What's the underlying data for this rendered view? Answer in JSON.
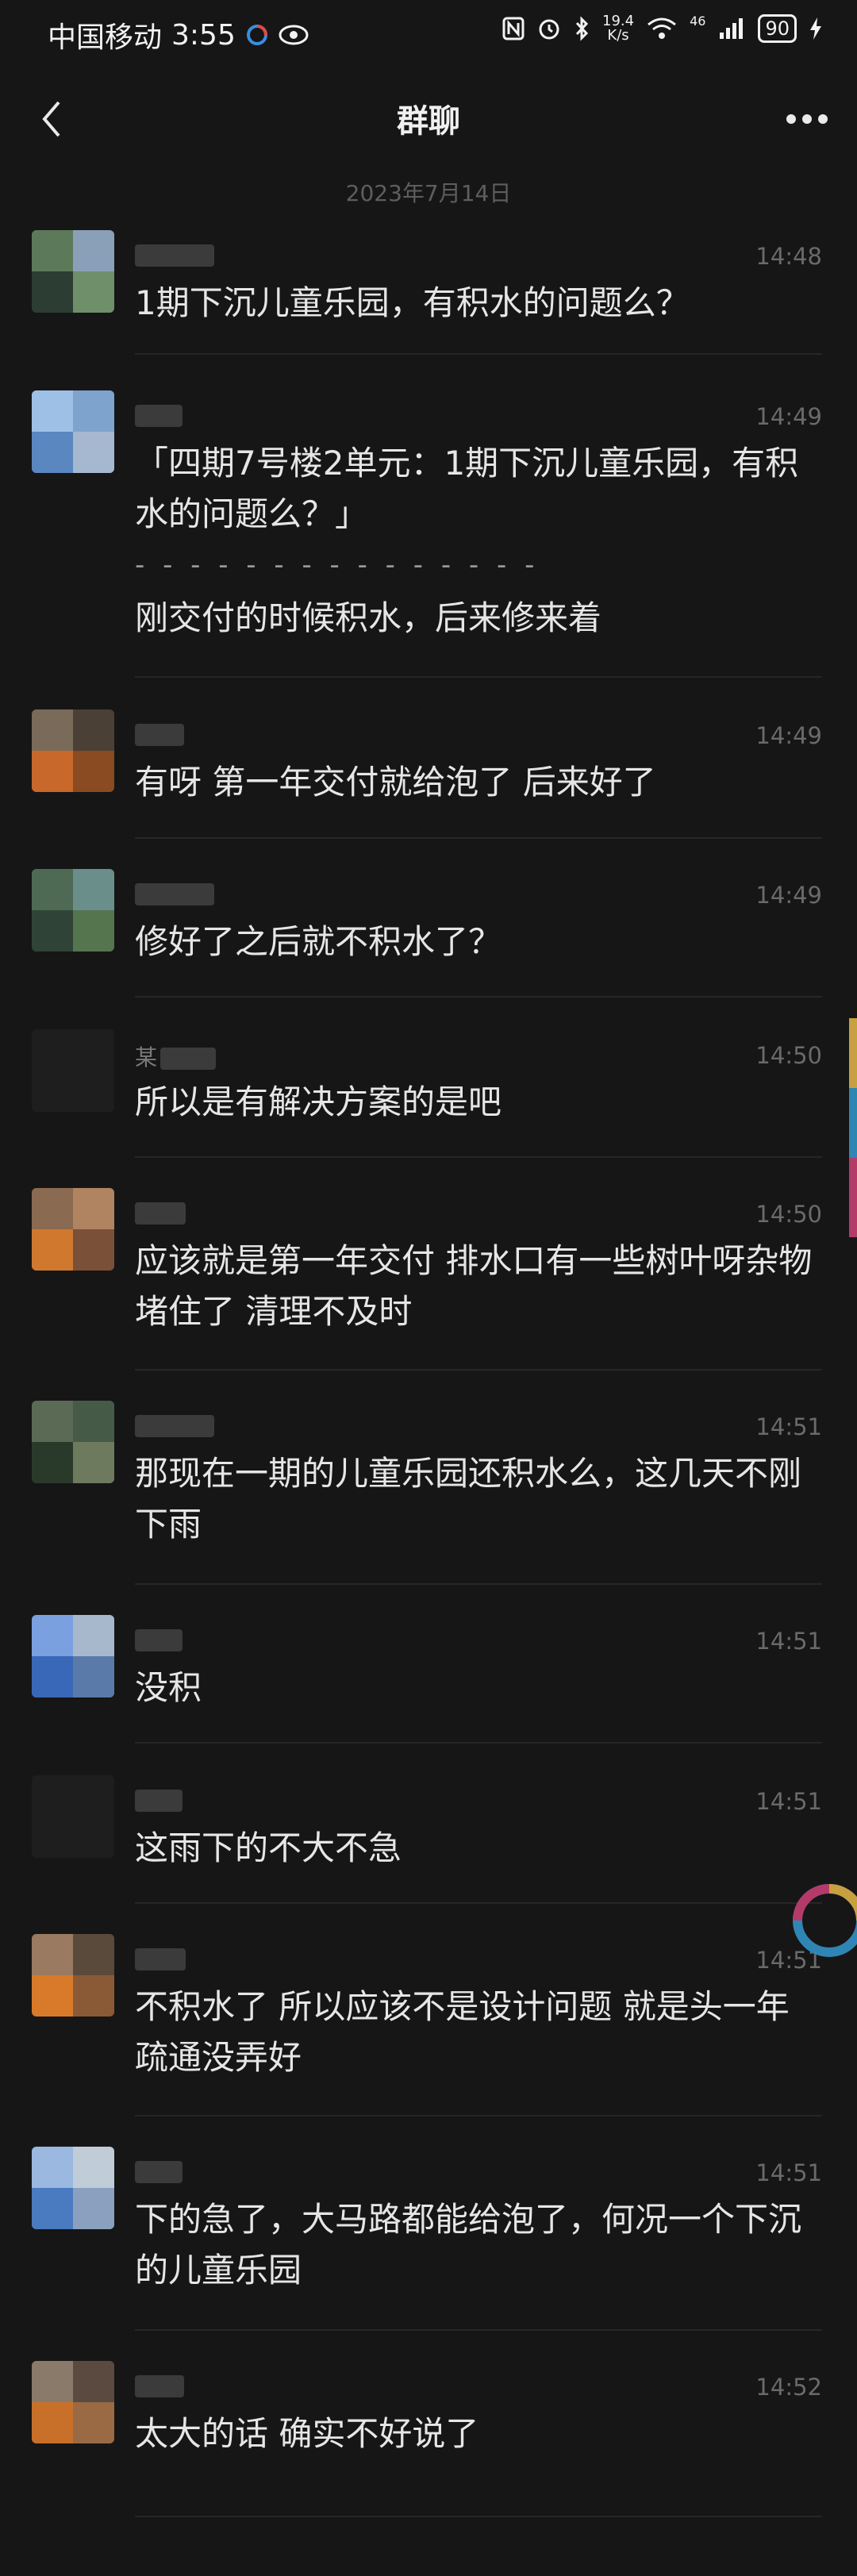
{
  "status_bar": {
    "carrier": "中国移动",
    "time": "3:55",
    "net_speed_value": "19.4",
    "net_speed_unit": "K/s",
    "signal_label": "46",
    "battery": "90"
  },
  "header": {
    "title": "群聊"
  },
  "date_separator": "2023年7月14日",
  "messages": [
    {
      "sender": "",
      "time": "14:48",
      "text": "1期下沉儿童乐园，有积水的问题么？"
    },
    {
      "sender": "",
      "time": "14:49",
      "quote": "「四期7号楼2单元：1期下沉儿童乐园，有积水的问题么？」",
      "dash": "- - - - - - - - - - - - - - -",
      "text": "刚交付的时候积水，后来修来着"
    },
    {
      "sender": "",
      "time": "14:49",
      "text": "有呀 第一年交付就给泡了 后来好了"
    },
    {
      "sender": "",
      "time": "14:49",
      "text": "修好了之后就不积水了？"
    },
    {
      "sender": "某",
      "time": "14:50",
      "text": "所以是有解决方案的是吧"
    },
    {
      "sender": "",
      "time": "14:50",
      "text": "应该就是第一年交付 排水口有一些树叶呀杂物堵住了 清理不及时"
    },
    {
      "sender": "",
      "time": "14:51",
      "text": "那现在一期的儿童乐园还积水么，这几天不刚下雨"
    },
    {
      "sender": "",
      "time": "14:51",
      "text": "没积"
    },
    {
      "sender": "",
      "time": "14:51",
      "text": "这雨下的不大不急"
    },
    {
      "sender": "",
      "time": "14:51",
      "text": "不积水了 所以应该不是设计问题 就是头一年疏通没弄好"
    },
    {
      "sender": "",
      "time": "14:51",
      "text": "下的急了，大马路都能给泡了，何况一个下沉的儿童乐园"
    },
    {
      "sender": "",
      "time": "14:52",
      "text": "太大的话 确实不好说了"
    }
  ],
  "colors": {
    "background": "#161616",
    "text": "#e6e6e6",
    "muted": "#6a6a6a"
  }
}
